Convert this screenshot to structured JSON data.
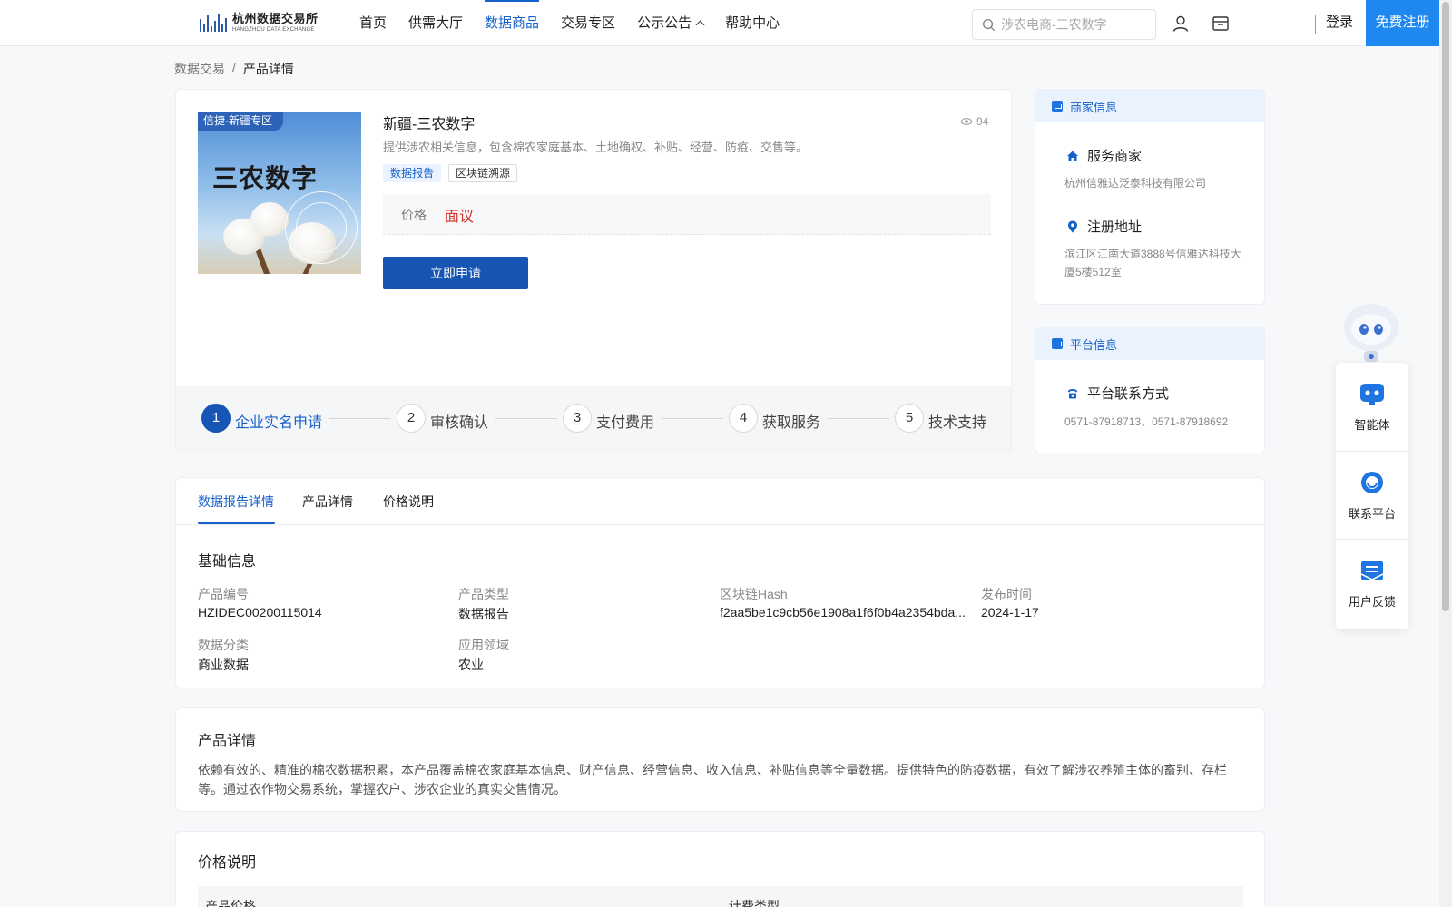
{
  "header": {
    "logo_cn": "杭州数据交易所",
    "logo_en": "HANGZHOU DATA EXCHANGE",
    "nav": [
      "首页",
      "供需大厅",
      "数据商品",
      "交易专区",
      "公示公告",
      "帮助中心"
    ],
    "active_nav": "数据商品",
    "search_placeholder": "涉农电商-三农数字",
    "login": "登录",
    "register": "免费注册"
  },
  "breadcrumb": {
    "parent": "数据交易",
    "separator": "/",
    "current": "产品详情"
  },
  "product": {
    "thumb_tag": "信捷-新疆专区",
    "thumb_title": "三农数字",
    "title": "新疆-三农数字",
    "views": "94",
    "description": "提供涉农相关信息，包含棉农家庭基本、土地确权、补贴、经营、防疫、交售等。",
    "tags": [
      "数据报告",
      "区块链溯源"
    ],
    "price_label": "价格",
    "price_value": "面议",
    "apply_button": "立即申请"
  },
  "steps": [
    {
      "num": "1",
      "label": "企业实名申请"
    },
    {
      "num": "2",
      "label": "审核确认"
    },
    {
      "num": "3",
      "label": "支付费用"
    },
    {
      "num": "4",
      "label": "获取服务"
    },
    {
      "num": "5",
      "label": "技术支持"
    }
  ],
  "merchant": {
    "header": "商家信息",
    "service_title": "服务商家",
    "service_value": "杭州信雅达泛泰科技有限公司",
    "address_title": "注册地址",
    "address_value": "滨江区江南大道3888号信雅达科技大厦5楼512室"
  },
  "platform": {
    "header": "平台信息",
    "contact_title": "平台联系方式",
    "contact_value": "0571-87918713、0571-87918692"
  },
  "tabs": [
    "数据报告详情",
    "产品详情",
    "价格说明"
  ],
  "basic_info": {
    "title": "基础信息",
    "fields": [
      {
        "label": "产品编号",
        "value": "HZIDEC00200115014"
      },
      {
        "label": "产品类型",
        "value": "数据报告"
      },
      {
        "label": "区块链Hash",
        "value": "f2aa5be1c9cb56e1908a1f6f0b4a2354bda..."
      },
      {
        "label": "发布时间",
        "value": "2024-1-17"
      },
      {
        "label": "数据分类",
        "value": "商业数据"
      },
      {
        "label": "应用领域",
        "value": "农业"
      }
    ]
  },
  "product_detail": {
    "title": "产品详情",
    "text": "依赖有效的、精准的棉农数据积累，本产品覆盖棉农家庭基本信息、财产信息、经营信息、收入信息、补贴信息等全量数据。提供特色的防疫数据，有效了解涉农养殖主体的畜别、存栏等。通过农作物交易系统，掌握农户、涉农企业的真实交售情况。"
  },
  "pricing": {
    "title": "价格说明",
    "columns": [
      "产品价格",
      "计费类型"
    ]
  },
  "float_widget": {
    "items": [
      "智能体",
      "联系平台",
      "用户反馈"
    ]
  },
  "colors": {
    "primary": "#1560c9",
    "button": "#1655b3",
    "register": "#1e88f0",
    "price": "#d03531"
  }
}
